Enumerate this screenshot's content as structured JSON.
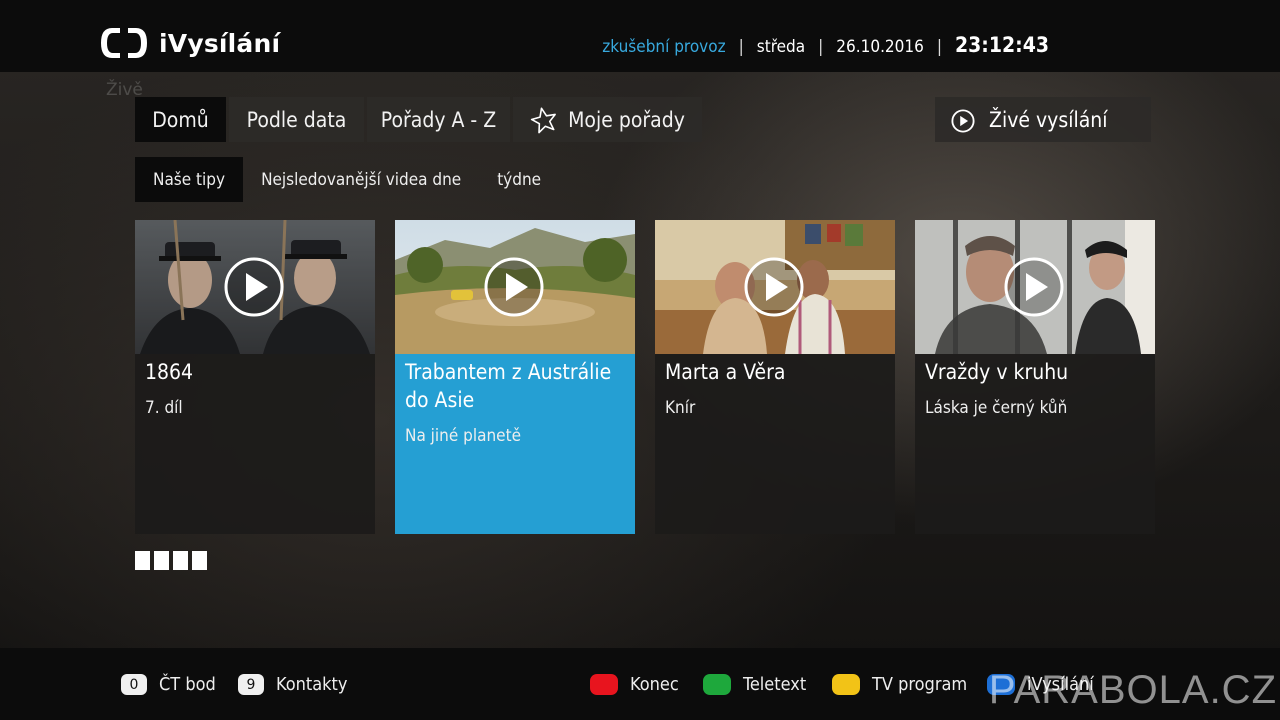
{
  "header": {
    "logo_text": "iVysílání",
    "trial_label": "zkušební provoz",
    "day": "středa",
    "date": "26.10.2016",
    "time": "23:12:43",
    "separator": "|",
    "ghost_text": "Živě"
  },
  "nav": {
    "tabs": [
      {
        "label": "Domů",
        "active": true
      },
      {
        "label": "Podle data",
        "active": false
      },
      {
        "label": "Pořady A - Z",
        "active": false
      },
      {
        "label": "Moje pořady",
        "active": false,
        "icon": "star-outline-icon"
      }
    ],
    "live_button": {
      "label": "Živé vysílání",
      "icon": "play-circle-icon"
    }
  },
  "subnav": {
    "tabs": [
      {
        "label": "Naše tipy",
        "active": true
      },
      {
        "label": "Nejsledovanější videa dne",
        "active": false
      },
      {
        "label": "týdne",
        "active": false
      }
    ]
  },
  "cards": [
    {
      "title": "1864",
      "subtitle": "7. díl",
      "selected": false,
      "thumb": "soldiers-in-uniform"
    },
    {
      "title": "Trabantem z Austrálie do Asie",
      "subtitle": "Na jiné planetě",
      "selected": true,
      "thumb": "car-in-landscape"
    },
    {
      "title": "Marta a Věra",
      "subtitle": "Knír",
      "selected": false,
      "thumb": "women-in-room"
    },
    {
      "title": "Vraždy v kruhu",
      "subtitle": "Láska je černý kůň",
      "selected": false,
      "thumb": "men-behind-bars"
    }
  ],
  "pager": {
    "pages": 4
  },
  "footer": {
    "left": [
      {
        "key": "0",
        "label": "ČT bod"
      },
      {
        "key": "9",
        "label": "Kontakty"
      }
    ],
    "right": [
      {
        "color": "#e8141e",
        "label": "Konec"
      },
      {
        "color": "#1ea83c",
        "label": "Teletext"
      },
      {
        "color": "#f2c317",
        "label": "TV program"
      },
      {
        "color": "#1d6fd6",
        "label": "iVysílání"
      }
    ]
  },
  "watermark": "PARABOLA.CZ",
  "colors": {
    "accent": "#259fd3",
    "trial_text": "#38a9de"
  }
}
